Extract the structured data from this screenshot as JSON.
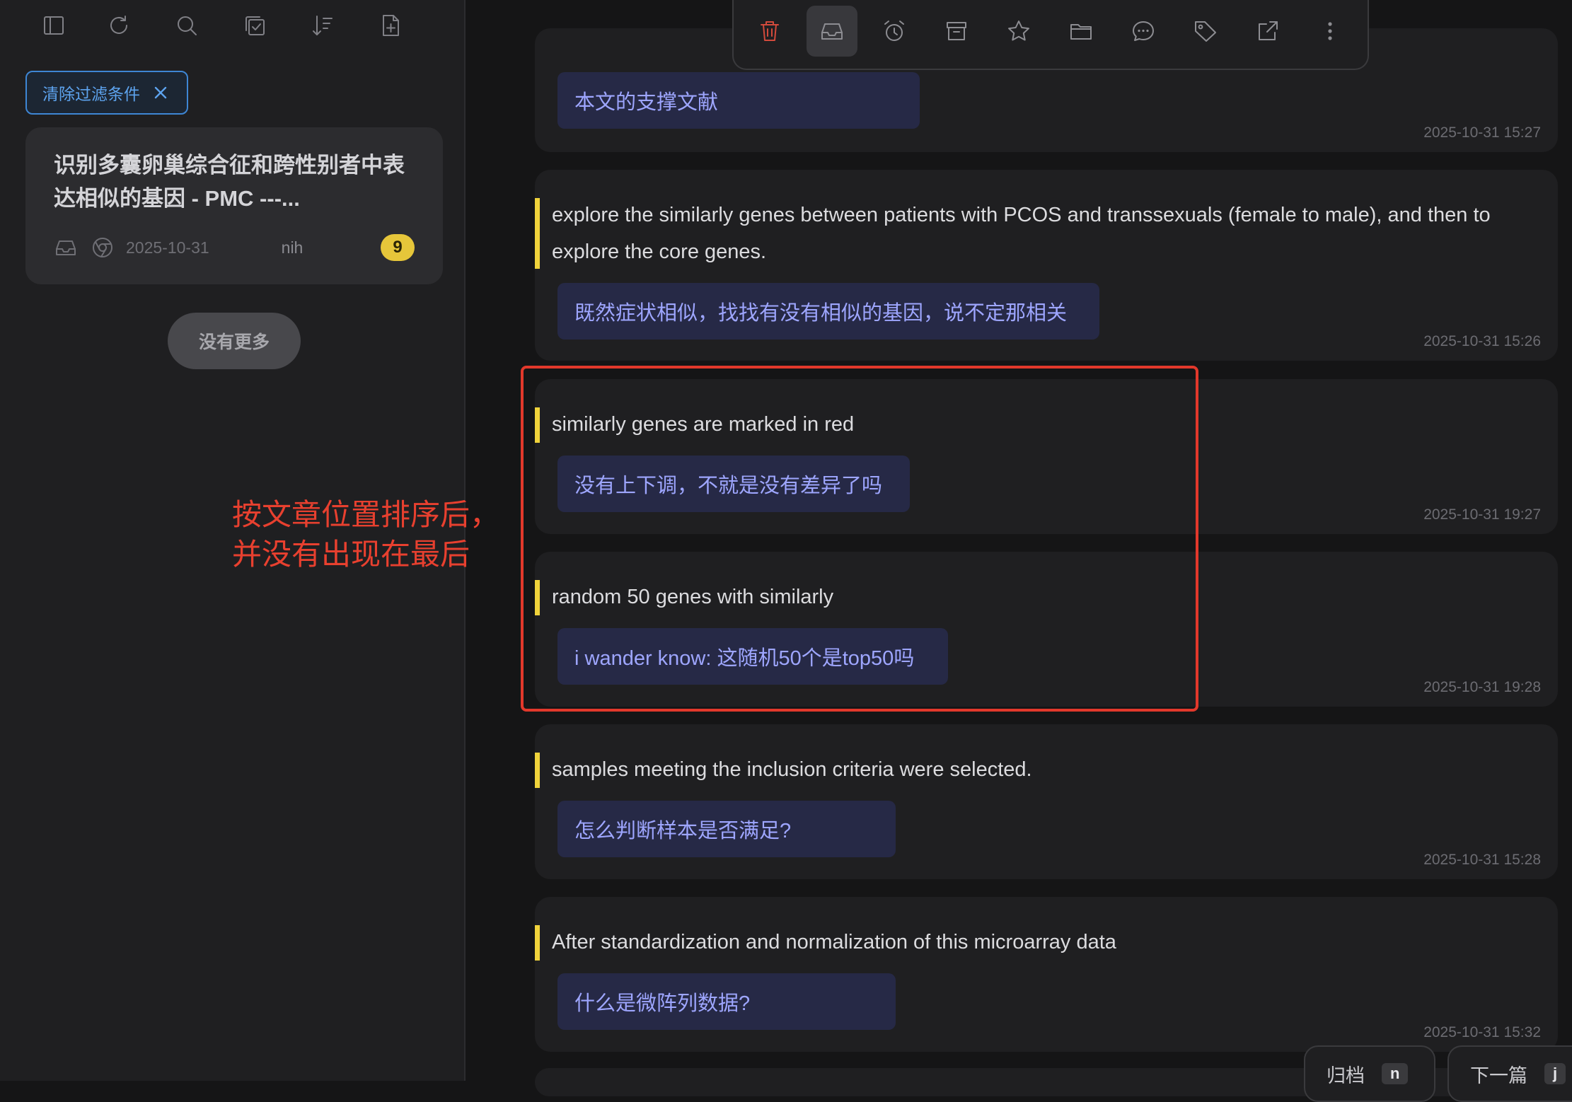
{
  "sidebar": {
    "tools": [
      "panel-icon",
      "refresh-icon",
      "search-icon",
      "select-all-icon",
      "sort-icon",
      "new-page-icon"
    ],
    "filter_chip": "清除过滤条件",
    "card": {
      "title": "识别多囊卵巢综合征和跨性别者中表达相似的基因 - PMC ---...",
      "date": "2025-10-31",
      "source": "nih",
      "count": "9"
    },
    "no_more": "没有更多"
  },
  "toolbar": {
    "buttons": [
      "trash-icon",
      "inbox-icon",
      "alarm-icon",
      "archive-icon",
      "star-icon",
      "folder-icon",
      "comment-icon",
      "tag-icon",
      "external-link-icon",
      "more-icon"
    ],
    "active": "inbox-icon",
    "danger_color": "#d24a3c"
  },
  "notes": [
    {
      "quote": "",
      "comment": "本文的支撑文献",
      "time": "2025-10-31 15:27"
    },
    {
      "quote": "explore the similarly genes between patients with PCOS and transsexuals (female to male), and then to explore the core genes.",
      "comment": "既然症状相似，找找有没有相似的基因，说不定那相关",
      "time": "2025-10-31 15:26"
    },
    {
      "quote": "similarly genes are marked in red",
      "comment": "没有上下调，不就是没有差异了吗",
      "time": "2025-10-31 19:27"
    },
    {
      "quote": "random 50 genes with similarly",
      "comment": "i wander know: 这随机50个是top50吗",
      "time": "2025-10-31 19:28"
    },
    {
      "quote": "samples meeting the inclusion criteria were selected.",
      "comment": "怎么判断样本是否满足?",
      "time": "2025-10-31 15:28"
    },
    {
      "quote": "After standardization and normalization of this microarray data",
      "comment": "什么是微阵列数据?",
      "time": "2025-10-31 15:32"
    }
  ],
  "annotation": "按文章位置排序后，并没有出现在最后",
  "bottom": {
    "archive_label": "归档",
    "archive_key": "n",
    "next_label": "下一篇",
    "next_key": "j"
  },
  "colors": {
    "highlight": "#f0d33b",
    "comment_text": "#9ea6ff",
    "annotation": "#e8402f",
    "accent": "#3e86d4",
    "badge": "#e6c63a"
  }
}
